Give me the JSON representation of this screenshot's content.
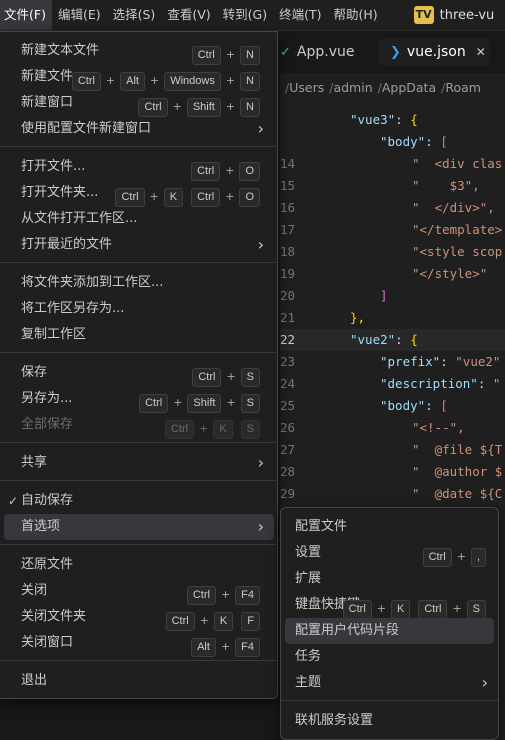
{
  "menubar": {
    "items": [
      "文件(F)",
      "编辑(E)",
      "选择(S)",
      "查看(V)",
      "转到(G)",
      "终端(T)",
      "帮助(H)"
    ],
    "badge": "TV",
    "title": "three-vu"
  },
  "tabs": [
    {
      "label": "App.vue",
      "icon": "vue-icon"
    },
    {
      "label": "vue.json",
      "icon": "json-icon",
      "close": "✕"
    }
  ],
  "breadcrumbs": [
    "Users",
    "admin",
    "AppData",
    "Roam"
  ],
  "code": {
    "gutter": [
      "",
      "",
      "14",
      "15",
      "16",
      "17",
      "18",
      "19",
      "20",
      "21",
      "22",
      "23",
      "24",
      "25",
      "26",
      "27",
      "28",
      "29"
    ]
  },
  "file_menu": {
    "groups": [
      [
        {
          "label": "新建文本文件",
          "keys": [
            "Ctrl",
            "N"
          ]
        },
        {
          "label": "新建文件...",
          "keys": [
            "Ctrl",
            "Alt",
            "Windows",
            "N"
          ]
        },
        {
          "label": "新建窗口",
          "keys": [
            "Ctrl",
            "Shift",
            "N"
          ]
        },
        {
          "label": "使用配置文件新建窗口",
          "submenu": true
        }
      ],
      [
        {
          "label": "打开文件...",
          "keys": [
            "Ctrl",
            "O"
          ]
        },
        {
          "label": "打开文件夹...",
          "keys": [
            "Ctrl",
            "K"
          ],
          "keys2": [
            "Ctrl",
            "O"
          ]
        },
        {
          "label": "从文件打开工作区..."
        },
        {
          "label": "打开最近的文件",
          "submenu": true
        }
      ],
      [
        {
          "label": "将文件夹添加到工作区..."
        },
        {
          "label": "将工作区另存为..."
        },
        {
          "label": "复制工作区"
        }
      ],
      [
        {
          "label": "保存",
          "keys": [
            "Ctrl",
            "S"
          ]
        },
        {
          "label": "另存为...",
          "keys": [
            "Ctrl",
            "Shift",
            "S"
          ]
        },
        {
          "label": "全部保存",
          "keys": [
            "Ctrl",
            "K"
          ],
          "keys2": [
            "S"
          ],
          "disabled": true
        }
      ],
      [
        {
          "label": "共享",
          "submenu": true
        }
      ],
      [
        {
          "label": "自动保存",
          "checked": true
        },
        {
          "label": "首选项",
          "submenu": true,
          "highlighted": true
        }
      ],
      [
        {
          "label": "还原文件"
        },
        {
          "label": "关闭",
          "keys": [
            "Ctrl",
            "F4"
          ]
        },
        {
          "label": "关闭文件夹",
          "keys": [
            "Ctrl",
            "K"
          ],
          "keys2": [
            "F"
          ]
        },
        {
          "label": "关闭窗口",
          "keys": [
            "Alt",
            "F4"
          ]
        }
      ],
      [
        {
          "label": "退出"
        }
      ]
    ]
  },
  "preferences_submenu": {
    "items": [
      {
        "label": "配置文件"
      },
      {
        "label": "设置",
        "keys": [
          "Ctrl",
          ","
        ]
      },
      {
        "label": "扩展"
      },
      {
        "label": "键盘快捷键",
        "keys": [
          "Ctrl",
          "K"
        ],
        "keys2": [
          "Ctrl",
          "S"
        ]
      },
      {
        "label": "配置用户代码片段",
        "highlighted": true
      },
      {
        "label": "任务"
      },
      {
        "label": "主题",
        "submenu": true
      },
      {
        "divider": true
      },
      {
        "label": "联机服务设置"
      }
    ]
  },
  "colors": {
    "menu_bg": "#1f1f1f",
    "highlight": "#37373d",
    "vue_green": "#41b883",
    "json_blue": "#3b9ee6",
    "badge": "#e2c04a"
  }
}
